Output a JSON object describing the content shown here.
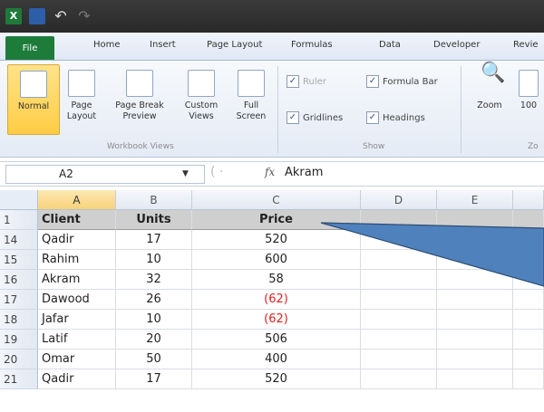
{
  "tabs": [
    "File",
    "Home",
    "Insert",
    "Page Layout",
    "Formulas",
    "Data",
    "Developer",
    "Revie"
  ],
  "ribbon": {
    "workbook_views": [
      {
        "label": "Normal",
        "sub": "",
        "selected": true
      },
      {
        "label": "Page",
        "sub": "Layout",
        "selected": false
      },
      {
        "label": "Page Break",
        "sub": "Preview",
        "selected": false
      },
      {
        "label": "Custom",
        "sub": "Views",
        "selected": false
      },
      {
        "label": "Full",
        "sub": "Screen",
        "selected": false
      }
    ],
    "group_workbook_views": "Workbook Views",
    "show": {
      "ruler": "Ruler",
      "formula_bar": "Formula Bar",
      "gridlines": "Gridlines",
      "headings": "Headings"
    },
    "group_show": "Show",
    "zoom": "Zoom",
    "zoom100": "100",
    "zoom_group_partial": "Zo"
  },
  "formula_bar": {
    "name_box": "A2",
    "fx": "fx",
    "value": "Akram"
  },
  "columns": [
    "A",
    "B",
    "C",
    "D",
    "E"
  ],
  "header_row": {
    "row": "1",
    "client": "Client",
    "units": "Units",
    "price": "Price"
  },
  "rows": [
    {
      "row": "14",
      "client": "Qadir",
      "units": "17",
      "price": "520",
      "negative": false
    },
    {
      "row": "15",
      "client": "Rahim",
      "units": "10",
      "price": "600",
      "negative": false
    },
    {
      "row": "16",
      "client": "Akram",
      "units": "32",
      "price": "58",
      "negative": false
    },
    {
      "row": "17",
      "client": "Dawood",
      "units": "26",
      "price": "(62)",
      "negative": true
    },
    {
      "row": "18",
      "client": "Jafar",
      "units": "10",
      "price": "(62)",
      "negative": true
    },
    {
      "row": "19",
      "client": "Latif",
      "units": "20",
      "price": "506",
      "negative": false
    },
    {
      "row": "20",
      "client": "Omar",
      "units": "50",
      "price": "400",
      "negative": false
    },
    {
      "row": "21",
      "client": "Qadir",
      "units": "17",
      "price": "520",
      "negative": false
    }
  ],
  "colors": {
    "negative": "#e02020",
    "file_tab": "#1e7c3a",
    "callout": "#4f81bd"
  }
}
